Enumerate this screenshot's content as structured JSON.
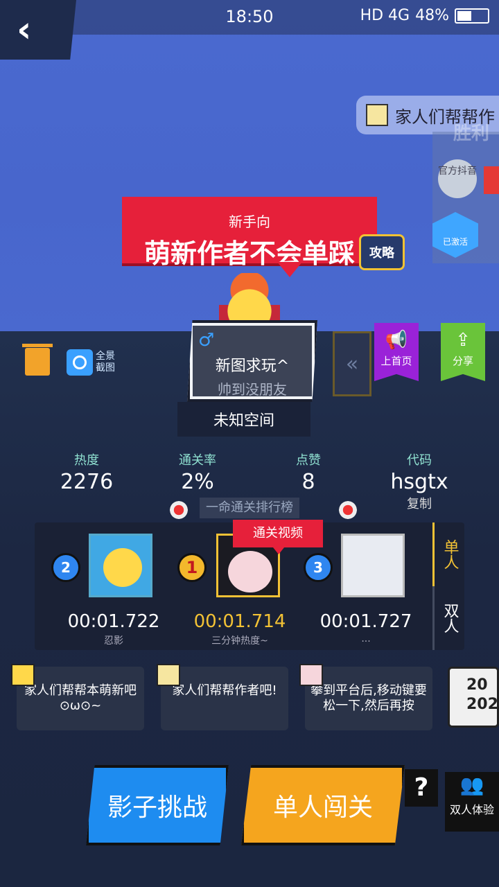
{
  "status_bar": {
    "signal": "4G",
    "time": "18:50",
    "network": "HD 4G",
    "battery": "48%"
  },
  "ticker": {
    "text": "家人们帮帮作",
    "victory": "胜利"
  },
  "side": {
    "official": "官方抖音",
    "activated": "已激活"
  },
  "banner": {
    "sub": "新手向",
    "title": "萌新作者不会单踩",
    "guide": "攻略"
  },
  "level_card": {
    "name": "新图求玩^",
    "author": "帅到没朋友",
    "space": "未知空间",
    "gender_icon": "male-icon"
  },
  "toolbar": {
    "panorama": "全景截图",
    "promote": "上首页",
    "share": "分享"
  },
  "stats": [
    {
      "label": "热度",
      "value": "2276"
    },
    {
      "label": "通关率",
      "value": "2%"
    },
    {
      "label": "点赞",
      "value": "8"
    },
    {
      "label": "代码",
      "value": "hsgtx",
      "action": "复制"
    }
  ],
  "leaderboard": {
    "title": "一命通关排行榜",
    "video_tag": "通关视频",
    "modes": [
      "单人",
      "双人"
    ],
    "entries": [
      {
        "rank": "2",
        "time": "00:01.722",
        "name": "忍影"
      },
      {
        "rank": "1",
        "time": "00:01.714",
        "name": "三分钟热度~"
      },
      {
        "rank": "3",
        "time": "00:01.727",
        "name": "..."
      }
    ]
  },
  "comments": [
    {
      "text": "家人们帮帮本萌新吧⊙ω⊙~"
    },
    {
      "text": "家人们帮帮作者吧!"
    },
    {
      "text": "攀到平台后,移动键要松一下,然后再按"
    }
  ],
  "calendar": {
    "top": "20",
    "bottom": "202"
  },
  "actions": {
    "shadow": "影子挑战",
    "solo": "单人闯关",
    "help": "?",
    "duo": "双人体验"
  },
  "colors": {
    "accent_red": "#e6203a",
    "gold": "#f3c235",
    "blue": "#1e8cf0",
    "orange": "#f5a51e"
  }
}
